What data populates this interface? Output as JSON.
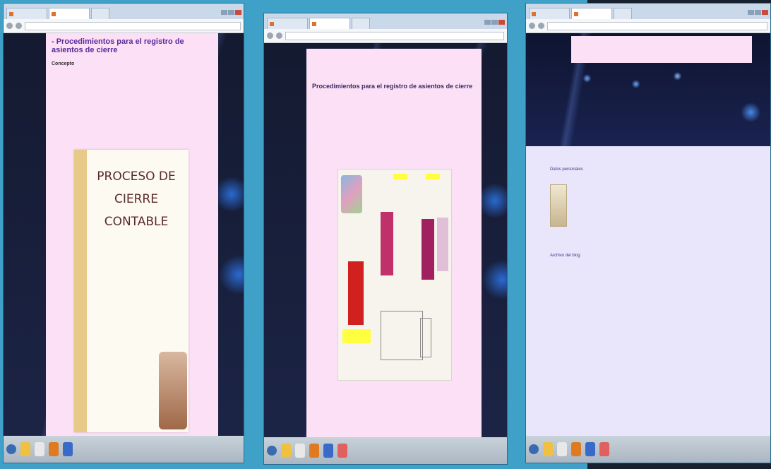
{
  "screens": [
    {
      "tabs": [
        "",
        "",
        ""
      ],
      "url": "",
      "post_title": "- Procedimientos para el registro de asientos de cierre",
      "subheading": "Concepto",
      "paragraph": "",
      "slide_title": "PROCESO DE CIERRE CONTABLE",
      "slide_paragraphs": [
        "",
        "",
        ""
      ]
    },
    {
      "tabs": [
        "",
        "",
        ""
      ],
      "url": "",
      "post_title": "Procedimientos para el registro de asientos de cierre",
      "paragraph": "",
      "footer_paragraph": ""
    },
    {
      "tabs": [
        "",
        "",
        ""
      ],
      "url": "",
      "nav_links": [
        "",
        ""
      ],
      "widget1_title": "Datos personales",
      "profile_name": "",
      "profile_link": "",
      "widget2_title": "Archivo del blog",
      "archive": [
        "",
        "",
        "",
        "",
        ""
      ],
      "footer": ""
    }
  ],
  "colors": {
    "post_bg": "#fbe0f6",
    "title_purple": "#5a2a9a",
    "desktop_blue": "#3fa0c8"
  }
}
